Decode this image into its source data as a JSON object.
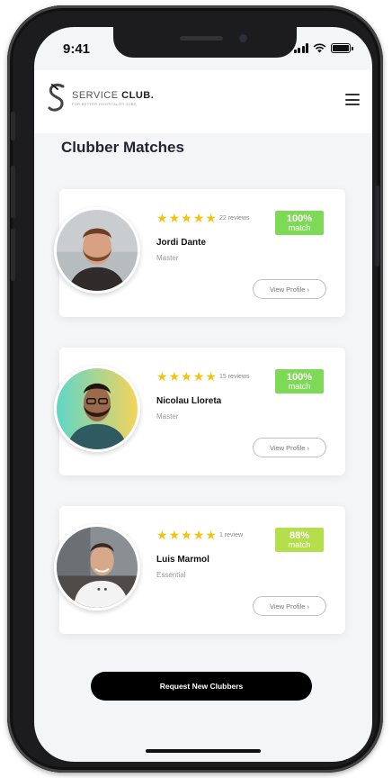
{
  "status_bar": {
    "time": "9:41"
  },
  "header": {
    "brand_prefix": "SERVICE ",
    "brand_strong": "CLUB.",
    "tagline": "FOR BETTER HOSPITALITY JOBS",
    "menu_icon": "hamburger-menu-icon"
  },
  "page": {
    "title": "Clubber Matches"
  },
  "matches": [
    {
      "name": "Jordi Dante",
      "tier": "Master",
      "rating": 5,
      "reviews": "22 reviews",
      "match_pct": "100%",
      "match_label": "match",
      "badge_color": "#7ed957",
      "view_label": "View Profile ›"
    },
    {
      "name": "Nicolau Lloreta",
      "tier": "Master",
      "rating": 5,
      "reviews": "15 reviews",
      "match_pct": "100%",
      "match_label": "match",
      "badge_color": "#7ed957",
      "view_label": "View Profile ›"
    },
    {
      "name": "Luis Marmol",
      "tier": "Essential",
      "rating": 5,
      "reviews": "1 review",
      "match_pct": "88%",
      "match_label": "match",
      "badge_color": "#b5de4c",
      "view_label": "View Profile ›"
    }
  ],
  "footer": {
    "request_label": "Request New Clubbers"
  },
  "colors": {
    "star": "#f2c312",
    "primary_button": "#000000",
    "screen_bg": "#f4f5f7"
  }
}
